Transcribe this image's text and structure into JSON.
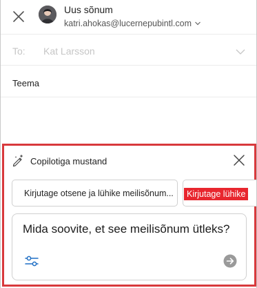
{
  "header": {
    "title": "Uus sõnum",
    "account": "katri.ahokas@lucernepubintl.com"
  },
  "to": {
    "label": "To:",
    "value": "Kat Larsson"
  },
  "subject": {
    "label": "Teema",
    "value": ""
  },
  "copilot": {
    "title": "Copilotiga mustand",
    "chips": [
      "Kirjutage otsene ja lühike meilisõnum...",
      "Kirjutage lühike"
    ],
    "prompt_placeholder": "Mida soovite, et see meilisõnum ütleks?"
  },
  "colors": {
    "highlight_border": "#d8393c",
    "chip_highlight": "#e8262e",
    "accent": "#1f6fc5"
  }
}
